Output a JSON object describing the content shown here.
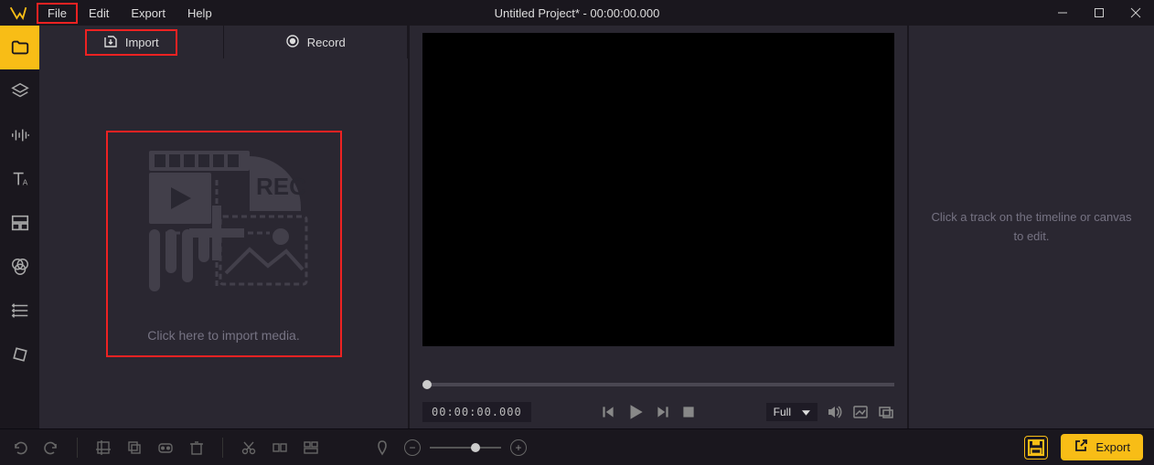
{
  "title": "Untitled Project* - 00:00:00.000",
  "menubar": {
    "file": "File",
    "edit": "Edit",
    "export": "Export",
    "help": "Help"
  },
  "media": {
    "import_tab": "Import",
    "record_tab": "Record",
    "drop_text": "Click here to import media."
  },
  "preview": {
    "timecode": "00:00:00.000",
    "display_mode": "Full"
  },
  "inspector": {
    "placeholder": "Click a track on the timeline or canvas to edit."
  },
  "bottom": {
    "export": "Export"
  },
  "colors": {
    "accent": "#f8bd16",
    "highlight": "#e22"
  }
}
